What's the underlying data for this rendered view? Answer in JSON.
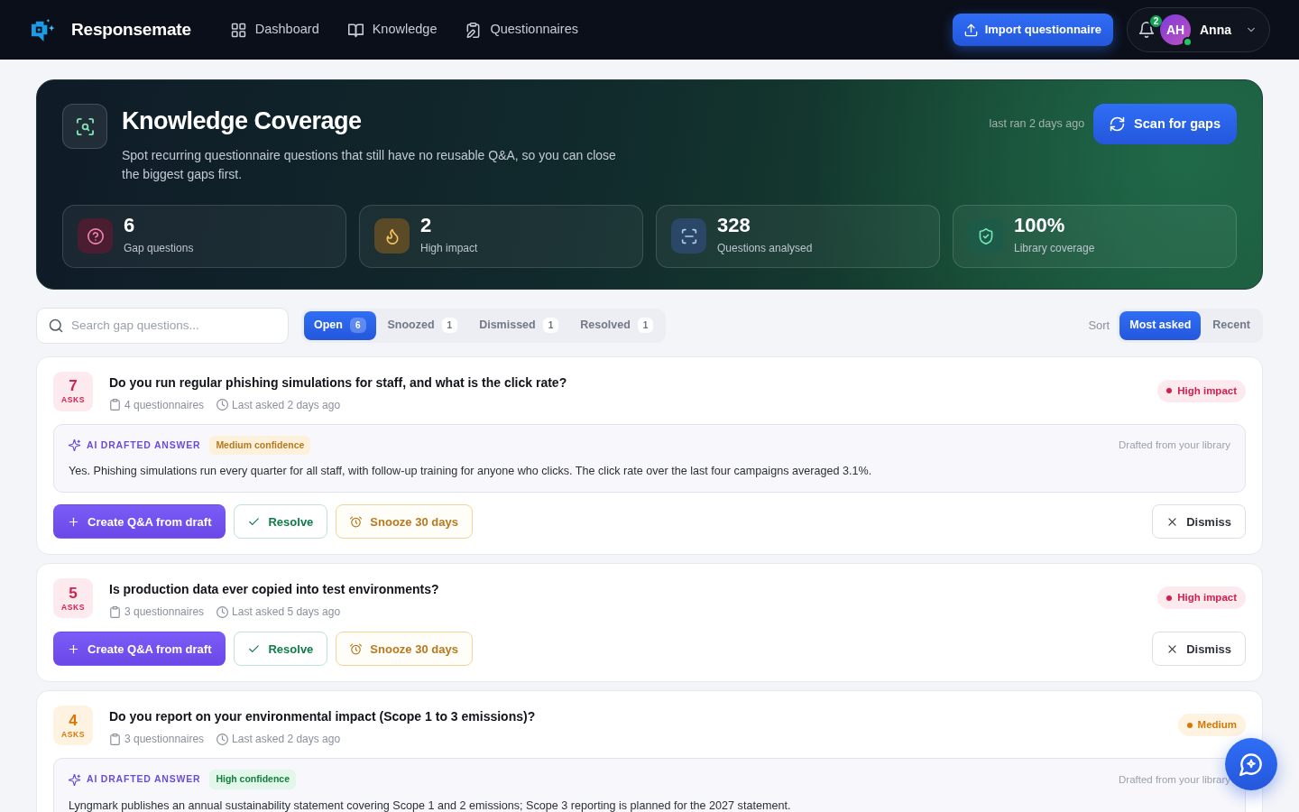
{
  "navbar": {
    "brand": "Responsemate",
    "links": [
      {
        "kind": "dashboard",
        "label": "Dashboard",
        "selected": false
      },
      {
        "kind": "knowledge",
        "label": "Knowledge",
        "selected": false
      },
      {
        "kind": "questionnaires",
        "label": "Questionnaires",
        "selected": false
      }
    ],
    "import_button": "Import questionnaire",
    "notifications": "2",
    "user": {
      "initials": "AH",
      "name": "Anna",
      "online": true
    }
  },
  "hero": {
    "title": "Knowledge Coverage",
    "description": "Spot recurring questionnaire questions that still have no reusable Q&A, so you can close the biggest gaps first.",
    "last_ran": "last ran 2 days ago",
    "scan_button": "Scan for gaps",
    "stats": [
      {
        "kind": "gaps",
        "value": "6",
        "label": "Gap questions"
      },
      {
        "kind": "impact",
        "value": "2",
        "label": "High impact"
      },
      {
        "kind": "analysed",
        "value": "328",
        "label": "Questions analysed"
      },
      {
        "kind": "coverage",
        "value": "100%",
        "label": "Library coverage"
      }
    ]
  },
  "filters": {
    "search": {
      "placeholder": "Search gap questions..."
    },
    "tabs": [
      {
        "label": "Open",
        "count": "6",
        "selected": true
      },
      {
        "label": "Snoozed",
        "count": "1",
        "selected": false
      },
      {
        "label": "Dismissed",
        "count": "1",
        "selected": false
      },
      {
        "label": "Resolved",
        "count": "1",
        "selected": false
      }
    ],
    "sort": {
      "label": "Sort",
      "options": [
        {
          "label": "Most asked",
          "selected": true
        },
        {
          "label": "Recent",
          "selected": false
        }
      ]
    }
  },
  "gaps": [
    {
      "asks": "7",
      "asks_label": "ASKS",
      "question": "Do you run regular phishing simulations for staff, and what is the click rate?",
      "questionnaires": "4 questionnaires",
      "last_asked": "Last asked 2 days ago",
      "impact": {
        "kind": "high",
        "label": "High impact"
      },
      "answer": {
        "heading": "AI DRAFTED ANSWER",
        "confidence": {
          "kind": "medium",
          "label": "Medium confidence"
        },
        "source": "Drafted from your library",
        "text": "Yes. Phishing simulations run every quarter for all staff, with follow-up training for anyone who clicks. The click rate over the last four campaigns averaged 3.1%."
      },
      "actions": [
        {
          "kind": "create",
          "label": "Create Q&A from draft"
        },
        {
          "kind": "resolve",
          "label": "Resolve"
        },
        {
          "kind": "snooze",
          "label": "Snooze 30 days"
        },
        {
          "kind": "dismiss",
          "label": "Dismiss"
        }
      ]
    },
    {
      "asks": "5",
      "asks_label": "ASKS",
      "question": "Is production data ever copied into test environments?",
      "questionnaires": "3 questionnaires",
      "last_asked": "Last asked 5 days ago",
      "impact": {
        "kind": "high",
        "label": "High impact"
      },
      "actions": [
        {
          "kind": "create",
          "label": "Create Q&A from draft"
        },
        {
          "kind": "resolve",
          "label": "Resolve"
        },
        {
          "kind": "snooze",
          "label": "Snooze 30 days"
        },
        {
          "kind": "dismiss",
          "label": "Dismiss"
        }
      ]
    },
    {
      "asks": "4",
      "asks_label": "ASKS",
      "question": "Do you report on your environmental impact (Scope 1 to 3 emissions)?",
      "questionnaires": "3 questionnaires",
      "last_asked": "Last asked 2 days ago",
      "impact": {
        "kind": "medium",
        "label": "Medium"
      },
      "answer": {
        "heading": "AI DRAFTED ANSWER",
        "confidence": {
          "kind": "high",
          "label": "High confidence"
        },
        "source": "Drafted from your library",
        "text": "Lyngmark publishes an annual sustainability statement covering Scope 1 and 2 emissions; Scope 3 reporting is planned for the 2027 statement."
      }
    }
  ]
}
